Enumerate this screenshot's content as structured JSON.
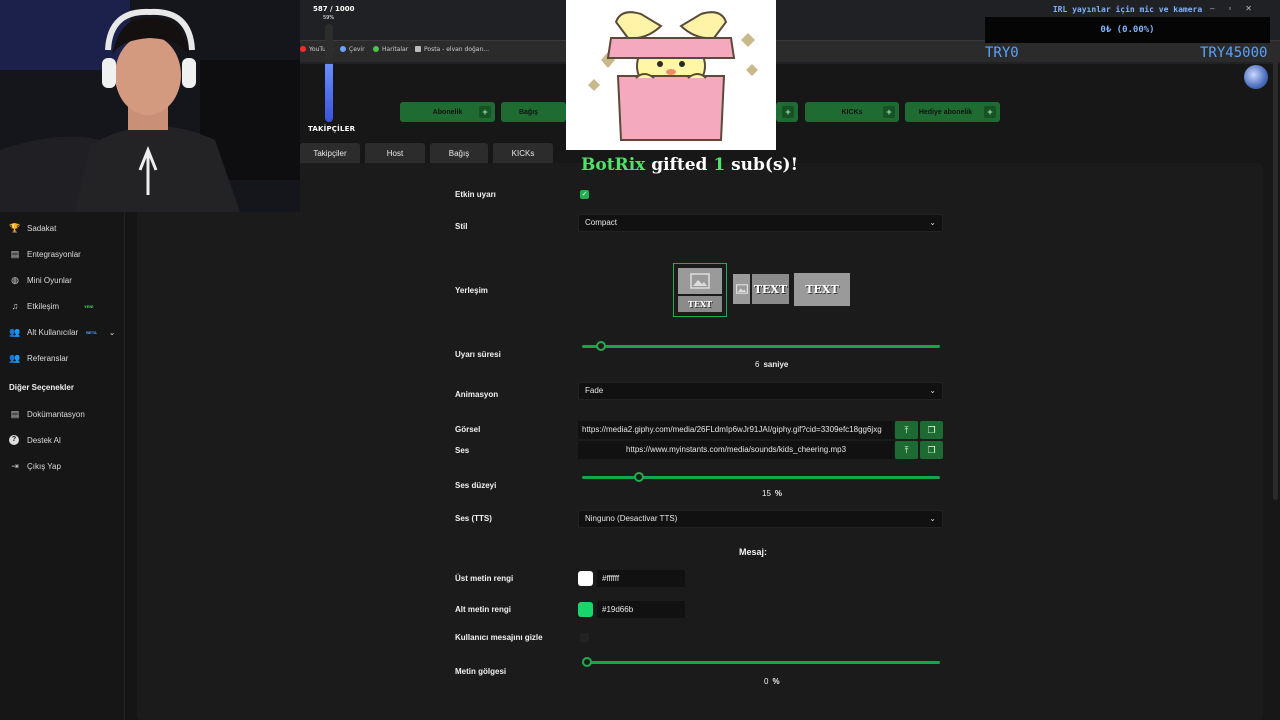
{
  "browser": {
    "bookmarks": [
      {
        "label": "YouTube",
        "color": "#ff2a2a"
      },
      {
        "label": "Çevir",
        "color": "#6fa1ff"
      },
      {
        "label": "Haritalar",
        "color": "#4cc24c"
      },
      {
        "label": "Posta - elvan doğan..."
      }
    ]
  },
  "webcam": {
    "icon": "person-webcam"
  },
  "follower_goal": {
    "count_text": "587 / 1000",
    "percent_text": "59%",
    "progress": 0.59,
    "label": "TAKİPÇİLER"
  },
  "overlay": {
    "irl_text": "IRL yayınlar için mic ve kamera",
    "goal_text": "0₺ (0.00%)",
    "goal_left": "TRY0",
    "goal_right": "TRY45000",
    "window_controls": [
      "–",
      "▫",
      "✕"
    ]
  },
  "alert_tabs": [
    {
      "label": "Abonelik"
    },
    {
      "label": "Bağış"
    },
    {
      "label": "KICKs"
    },
    {
      "label": "Hediye abonelik"
    }
  ],
  "section_tabs": [
    "Takipçiler",
    "Host",
    "Bağış",
    "KICKs"
  ],
  "gift_alert": {
    "user": "BotRix",
    "text1": "gifted",
    "count": "1",
    "text2": "sub(s)!"
  },
  "sidebar": {
    "items": [
      {
        "label": "Sadakat",
        "icon": "trophy-icon",
        "glyph": "🏆"
      },
      {
        "label": "Entegrasyonlar",
        "icon": "puzzle-icon",
        "glyph": "▤"
      },
      {
        "label": "Mini Oyunlar",
        "icon": "gamepad-icon",
        "glyph": "◍"
      },
      {
        "label": "Etkileşim",
        "icon": "music-icon",
        "glyph": "♫",
        "badge": "YENİ",
        "badge_color": "#3ddc68"
      },
      {
        "label": "Alt Kullanıcılar",
        "icon": "users-icon",
        "glyph": "👥",
        "badge": "BETA",
        "badge_color": "#5aa3ff",
        "has_chevron": true
      },
      {
        "label": "Referanslar",
        "icon": "referral-icon",
        "glyph": "👥"
      }
    ],
    "other_title": "Diğer Seçenekler",
    "other_items": [
      {
        "label": "Dokümantasyon",
        "icon": "book-icon",
        "glyph": "▤"
      },
      {
        "label": "Destek Al",
        "icon": "help-icon",
        "glyph": "?"
      },
      {
        "label": "Çıkış Yap",
        "icon": "logout-icon",
        "glyph": "⇥"
      }
    ]
  },
  "form": {
    "enabled_label": "Etkin uyarı",
    "enabled": true,
    "style_label": "Stil",
    "style_value": "Compact",
    "placement_label": "Yerleşim",
    "placement_text": "TEXT",
    "duration_label": "Uyarı süresi",
    "duration_value": "6",
    "duration_unit": "saniye",
    "duration_fraction": 0.04,
    "animation_label": "Animasyon",
    "animation_value": "Fade",
    "image_label": "Görsel",
    "image_url": "https://media2.giphy.com/media/26FLdmIp6wJr91JAI/giphy.gif?cid=3309efc18gg6jxg",
    "sound_label": "Ses",
    "sound_url": "https://www.myinstants.com/media/sounds/kids_cheering.mp3",
    "volume_label": "Ses düzeyi",
    "volume_value": "15",
    "volume_unit": "%",
    "volume_fraction": 0.15,
    "tts_label": "Ses (TTS)",
    "tts_value": "Ninguno (Desactivar TTS)",
    "message_heading": "Mesaj:",
    "top_color_label": "Üst metin rengi",
    "top_color": "#ffffff",
    "bottom_color_label": "Alt metin rengi",
    "bottom_color": "#19d66b",
    "hide_msg_label": "Kullanıcı mesajını gizle",
    "shadow_label": "Metin gölgesi",
    "shadow_value": "0",
    "shadow_unit": "%",
    "shadow_fraction": 0
  }
}
